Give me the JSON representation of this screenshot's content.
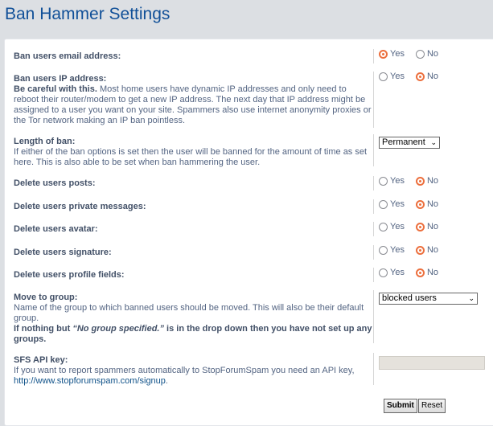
{
  "page": {
    "title": "Ban Hammer Settings"
  },
  "accent_color": "#ec6f3d",
  "title_color": "#115098",
  "settings": {
    "ban_email": {
      "label": "Ban users email address:",
      "options": [
        {
          "label": "Yes",
          "checked": true
        },
        {
          "label": "No",
          "checked": false
        }
      ]
    },
    "ban_ip": {
      "label": "Ban users IP address:",
      "warning": "Be careful with this.",
      "description": " Most home users have dynamic IP addresses and only need to reboot their router/modem to get a new IP address. The next day that IP address might be assigned to a user you want on your site. Spammers also use internet anonymity proxies or the Tor network making an IP ban pointless.",
      "options": [
        {
          "label": "Yes",
          "checked": false
        },
        {
          "label": "No",
          "checked": true
        }
      ]
    },
    "ban_length": {
      "label": "Length of ban:",
      "description": "If either of the ban options is set then the user will be banned for the amount of time as set here. This is also able to be set when ban hammering the user.",
      "selected": "Permanent"
    },
    "delete_posts": {
      "label": "Delete users posts:",
      "options": [
        {
          "label": "Yes",
          "checked": false
        },
        {
          "label": "No",
          "checked": true
        }
      ]
    },
    "delete_pms": {
      "label": "Delete users private messages:",
      "options": [
        {
          "label": "Yes",
          "checked": false
        },
        {
          "label": "No",
          "checked": true
        }
      ]
    },
    "delete_avatar": {
      "label": "Delete users avatar:",
      "options": [
        {
          "label": "Yes",
          "checked": false
        },
        {
          "label": "No",
          "checked": true
        }
      ]
    },
    "delete_signature": {
      "label": "Delete users signature:",
      "options": [
        {
          "label": "Yes",
          "checked": false
        },
        {
          "label": "No",
          "checked": true
        }
      ]
    },
    "delete_profile_fields": {
      "label": "Delete users profile fields:",
      "options": [
        {
          "label": "Yes",
          "checked": false
        },
        {
          "label": "No",
          "checked": true
        }
      ]
    },
    "move_group": {
      "label": "Move to group:",
      "description": "Name of the group to which banned users should be moved. This will also be their default group.",
      "note_prefix": "If nothing but ",
      "note_italic": "“No group specified.”",
      "note_suffix": " is in the drop down then you have not set up any groups.",
      "selected": "blocked users"
    },
    "sfs_api_key": {
      "label": "SFS API key:",
      "description": "If you want to report spammers automatically to StopForumSpam you need an API key,",
      "link": "http://www.stopforumspam.com/signup",
      "link_suffix": ".",
      "value": ""
    }
  },
  "buttons": {
    "submit": "Submit",
    "reset": "Reset"
  },
  "icons": {
    "select_chevron": "chevron-down-icon"
  }
}
